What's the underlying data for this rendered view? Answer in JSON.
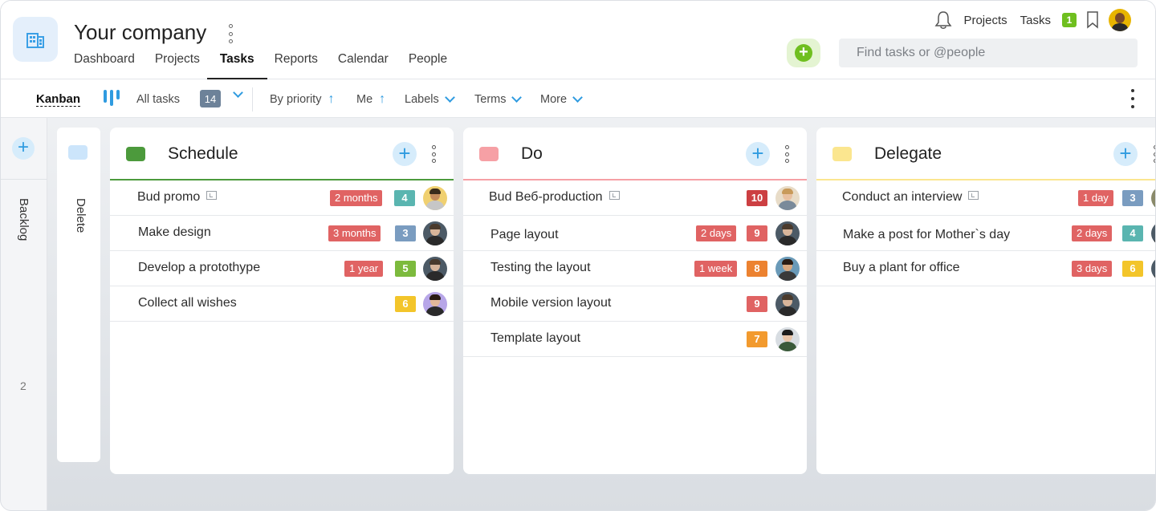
{
  "header": {
    "company": "Your company",
    "nav": [
      "Dashboard",
      "Projects",
      "Tasks",
      "Reports",
      "Calendar",
      "People"
    ],
    "active_nav": "Tasks",
    "top_links": {
      "projects": "Projects",
      "tasks": "Tasks",
      "tasks_badge": "1"
    },
    "search_placeholder": "Find tasks or @people"
  },
  "toolbar": {
    "view": "Kanban",
    "all_tasks": "All tasks",
    "count": "14",
    "by_priority": "By priority",
    "me": "Me",
    "labels": "Labels",
    "terms": "Terms",
    "more": "More"
  },
  "backlog": {
    "label": "Backlog",
    "count": "2"
  },
  "delete_column": {
    "label": "Delete"
  },
  "columns": {
    "schedule": {
      "title": "Schedule",
      "color": "#4c9a3c",
      "tasks": [
        {
          "name": "Bud promo",
          "term": "2 months",
          "priority": "4",
          "priority_color": "#5ab5b0"
        },
        {
          "name": "Make design",
          "term": "3 months",
          "priority": "3",
          "priority_color": "#7a9cc0"
        },
        {
          "name": "Develop a protothype",
          "term": "1 year",
          "priority": "5",
          "priority_color": "#7cba3d"
        },
        {
          "name": "Collect all wishes",
          "term": "",
          "priority": "6",
          "priority_color": "#f3c52a"
        }
      ]
    },
    "do": {
      "title": "Do",
      "color": "#f6a0a5",
      "tasks": [
        {
          "name": "Bud Веб-production",
          "term": "",
          "priority": "10",
          "priority_color": "#cc3f42"
        },
        {
          "name": "Page layout",
          "term": "2 days",
          "priority": "9",
          "priority_color": "#e06363"
        },
        {
          "name": "Testing the layout",
          "term": "1 week",
          "priority": "8",
          "priority_color": "#ec8230"
        },
        {
          "name": "Mobile version layout",
          "term": "",
          "priority": "9",
          "priority_color": "#e06363"
        },
        {
          "name": "Template layout",
          "term": "",
          "priority": "7",
          "priority_color": "#f29a2e"
        }
      ]
    },
    "delegate": {
      "title": "Delegate",
      "color": "#fbe68f",
      "tasks": [
        {
          "name": "Conduct an interview",
          "term": "1 day",
          "priority": "3",
          "priority_color": "#7a9cc0"
        },
        {
          "name": "Make a post for Mother`s day",
          "term": "2 days",
          "priority": "4",
          "priority_color": "#5ab5b0"
        },
        {
          "name": "Buy a plant for office",
          "term": "3 days",
          "priority": "6",
          "priority_color": "#f3c52a"
        }
      ]
    }
  }
}
